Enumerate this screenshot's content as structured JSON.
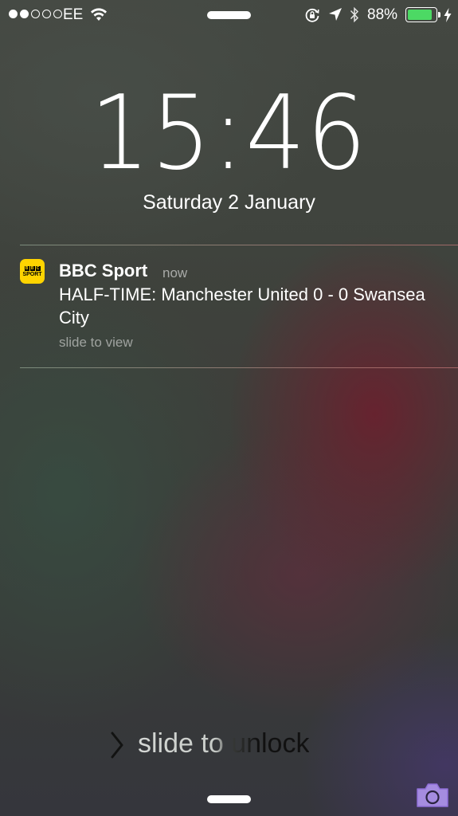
{
  "status_bar": {
    "signal_strength": 2,
    "signal_max": 5,
    "carrier": "EE",
    "battery_percent": "88%",
    "battery_level": 0.88,
    "battery_color": "#4cd964",
    "icons": [
      "wifi-icon",
      "rotation-lock-icon",
      "location-arrow-icon",
      "bluetooth-icon",
      "charging-bolt-icon"
    ]
  },
  "lock_screen": {
    "time": "15:46",
    "date": "Saturday 2 January"
  },
  "notification": {
    "app_name": "BBC Sport",
    "app_icon": {
      "blocks": [
        "B",
        "B",
        "C"
      ],
      "label": "SPORT",
      "color": "#ffd400"
    },
    "time": "now",
    "message": "HALF-TIME: Manchester United 0 - 0 Swansea City",
    "action_hint": "slide to view"
  },
  "unlock": {
    "label": "slide to unlock",
    "chevron_icon": "chevron-right-icon",
    "camera_icon": "camera-icon"
  }
}
